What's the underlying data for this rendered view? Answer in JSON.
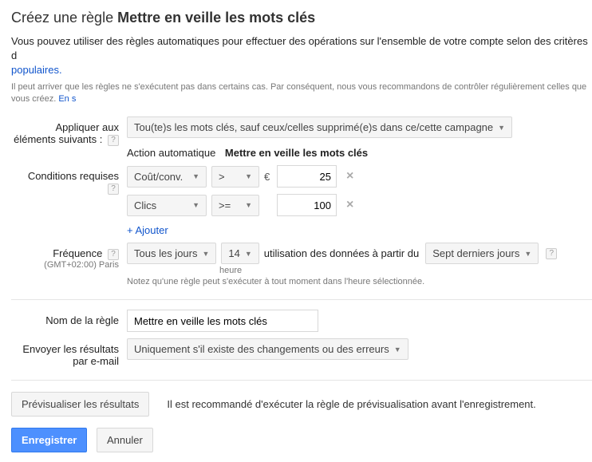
{
  "title_prefix": "Créez une règle ",
  "title_bold": "Mettre en veille les mots clés",
  "intro_text": "Vous pouvez utiliser des règles automatiques pour effectuer des opérations sur l'ensemble de votre compte selon des critères d",
  "intro_link": "populaires.",
  "warning_text": "Il peut arriver que les règles ne s'exécutent pas dans certains cas. Par conséquent, nous vous recommandons de contrôler régulièrement celles que vous créez. ",
  "warning_link": "En s",
  "labels": {
    "apply_to": "Appliquer aux éléments suivants :",
    "conditions": "Conditions requises",
    "frequency": "Fréquence",
    "timezone": "(GMT+02:00) Paris",
    "rule_name": "Nom de la règle",
    "email": "Envoyer les résultats par e-mail"
  },
  "apply_to_value": "Tou(te)s les mots clés, sauf ceux/celles supprimé(e)s dans ce/cette campagne",
  "action_label": "Action automatique",
  "action_value": "Mettre en veille les mots clés",
  "conditions": [
    {
      "metric": "Coût/conv.",
      "op": ">",
      "prefix": "€",
      "value": "25"
    },
    {
      "metric": "Clics",
      "op": ">=",
      "prefix": "",
      "value": "100"
    }
  ],
  "add_label": "+ Ajouter",
  "frequency": {
    "period": "Tous les jours",
    "hour": "14",
    "hour_label": "heure",
    "data_text": "utilisation des données à partir du",
    "data_range": "Sept derniers jours",
    "note": "Notez qu'une règle peut s'exécuter à tout moment dans l'heure sélectionnée."
  },
  "rule_name_value": "Mettre en veille les mots clés",
  "email_value": "Uniquement s'il existe des changements ou des erreurs",
  "preview_button": "Prévisualiser les résultats",
  "preview_msg": "Il est recommandé d'exécuter la règle de prévisualisation avant l'enregistrement.",
  "save_label": "Enregistrer",
  "cancel_label": "Annuler",
  "help_glyph": "?"
}
